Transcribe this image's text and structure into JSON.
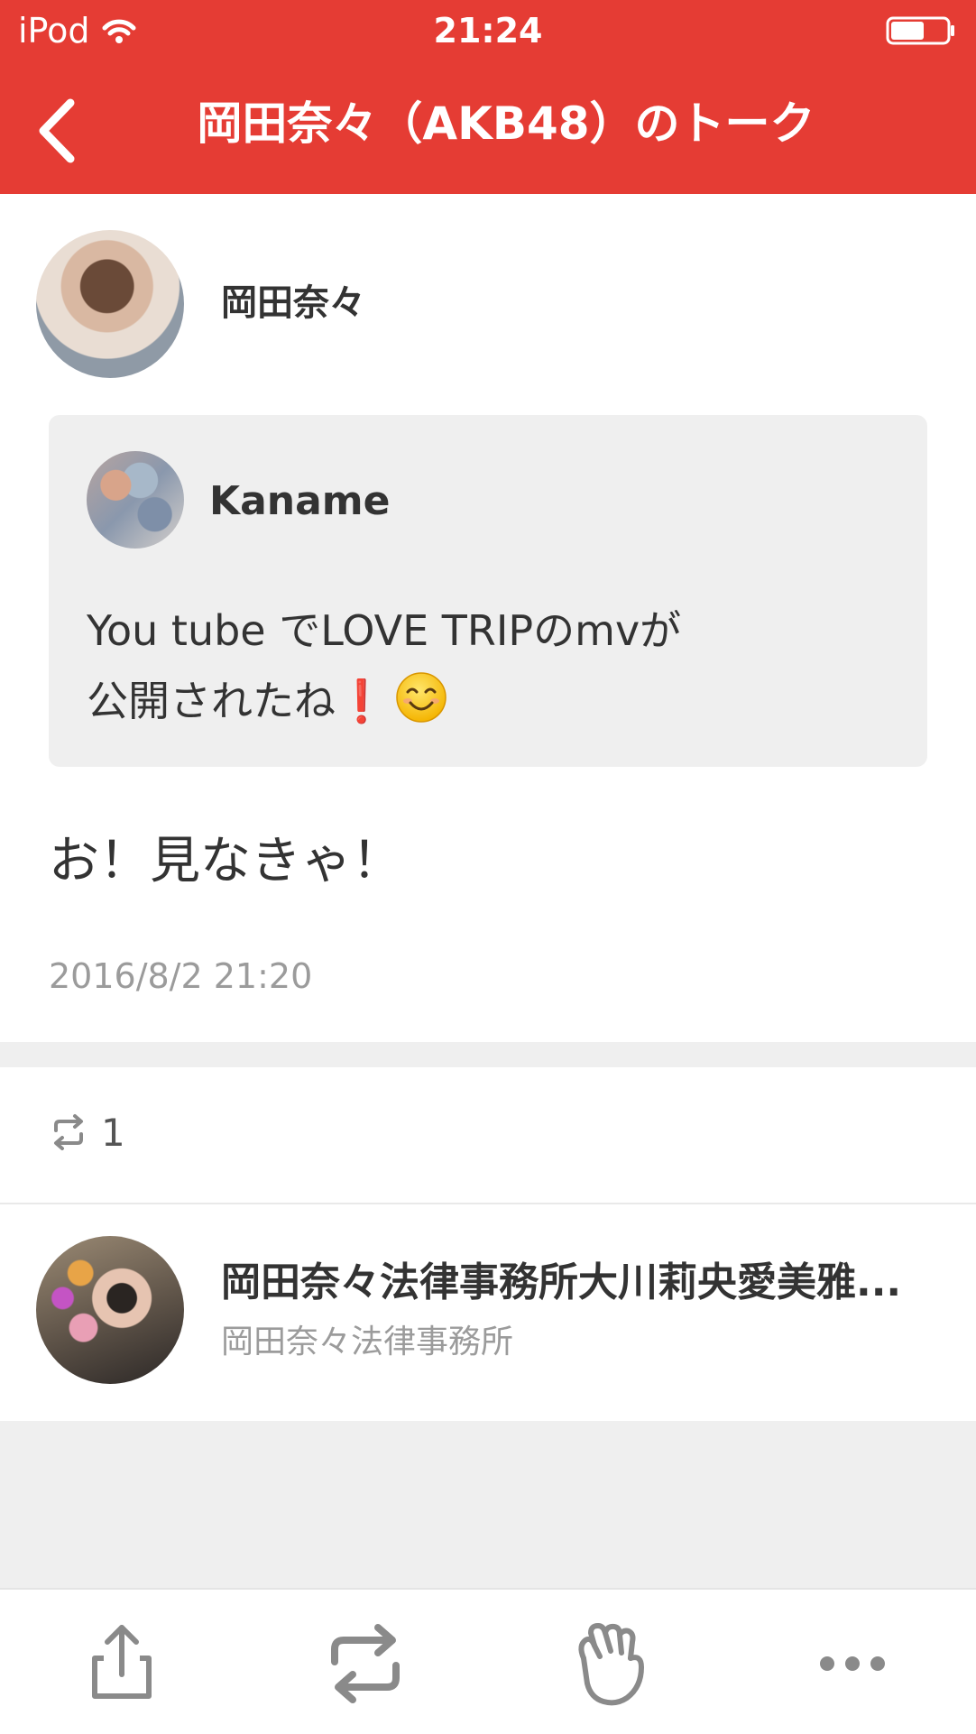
{
  "status_bar": {
    "carrier": "iPod",
    "time": "21:24"
  },
  "nav": {
    "title": "岡田奈々（AKB48）のトーク"
  },
  "post": {
    "author_name": "岡田奈々",
    "quote": {
      "name": "Kaname",
      "line1": "You tube でLOVE TRIPのmvが",
      "line2": "公開されたね",
      "emoji_exclaim": "❗"
    },
    "text": "お！見なきゃ！",
    "timestamp": "2016/8/2 21:20"
  },
  "reposts": {
    "count": "1"
  },
  "reposter": {
    "name": "岡田奈々法律事務所大川莉央愛美雅...",
    "subtitle": "岡田奈々法律事務所"
  },
  "toolbar": {
    "icons": [
      "share-icon",
      "repost-icon",
      "applause-icon",
      "more-icon"
    ]
  },
  "colors": {
    "header": "#e53c34",
    "background": "#ffffff",
    "card": "#efefef",
    "muted_text": "#9b9b9b"
  }
}
